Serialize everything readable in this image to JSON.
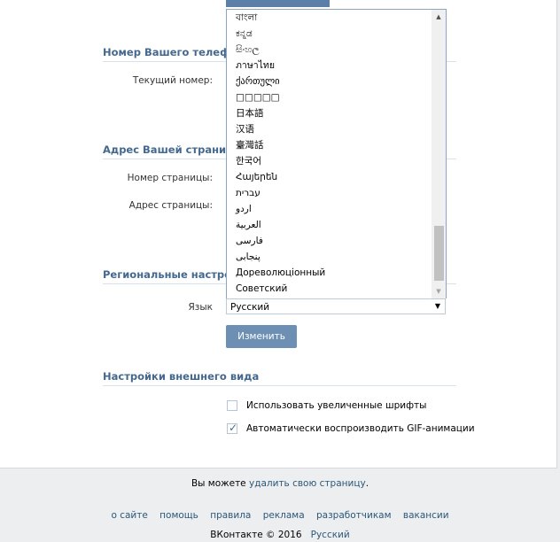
{
  "sections": {
    "phone": {
      "title": "Номер Вашего телефона",
      "current_label": "Текущий номер:"
    },
    "address": {
      "title": "Адрес Вашей страницы",
      "page_number_label": "Номер страницы:",
      "page_address_label": "Адрес страницы:"
    },
    "regional": {
      "title": "Региональные настройки",
      "language_label": "Язык",
      "language_value": "Русский",
      "save_label": "Изменить"
    },
    "appearance": {
      "title": "Настройки внешнего вида",
      "options": [
        {
          "label": "Использовать увеличенные шрифты",
          "checked": false
        },
        {
          "label": "Автоматически воспроизводить GIF-анимации",
          "checked": true
        }
      ]
    }
  },
  "language_options": [
    "বাংলা",
    "ಕನ್ನಡ",
    "සිංහල",
    "ภาษาไทย",
    "ქართული",
    "□□□□□",
    "日本語",
    "汉语",
    "臺灣話",
    "한국어",
    "Հայերեն",
    "עברית",
    "اردو",
    "العربية",
    "فارسی",
    "پنجابی",
    "Дореволюціонный",
    "Советский"
  ],
  "footer": {
    "message_prefix": "Вы можете",
    "message_link": "удалить свою страницу",
    "message_suffix": ".",
    "links": [
      "о сайте",
      "помощь",
      "правила",
      "реклама",
      "разработчикам",
      "вакансии"
    ],
    "copyright": "ВКонтакте © 2016",
    "language_link": "Русский"
  }
}
